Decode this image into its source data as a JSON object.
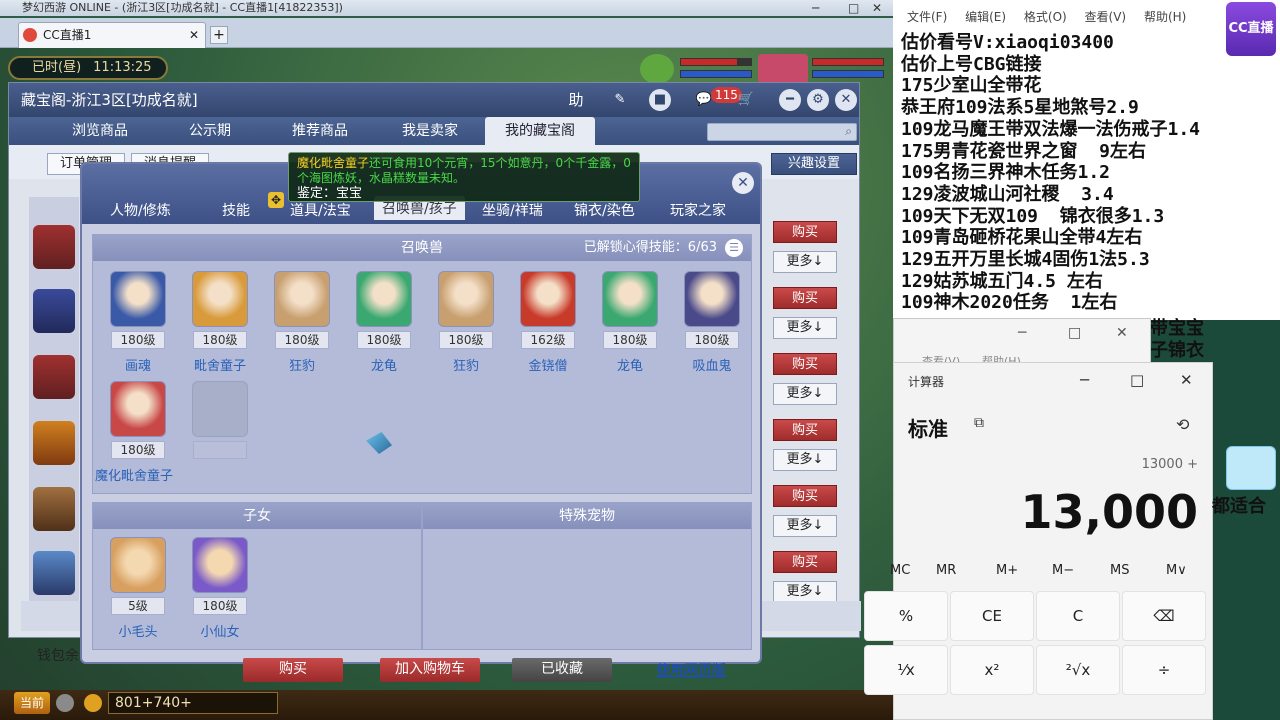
{
  "window": {
    "title": "梦幻西游 ONLINE - (浙江3区[功成名就] - CC直播1[41822353])"
  },
  "browser": {
    "tab_title": "CC直播1",
    "add_tab": "+"
  },
  "game_clock": {
    "period": "已时(昼)",
    "time": "11:13:25"
  },
  "cbg": {
    "title": "藏宝阁-浙江3区[功成名就]",
    "header_icons": [
      "助",
      "pen-icon",
      "stop-icon",
      "chat-icon",
      "cart-icon",
      "minimize-icon",
      "settings-icon",
      "close-icon"
    ],
    "cart_badge": "115",
    "nav_tabs": [
      "浏览商品",
      "公示期",
      "推荐商品",
      "我是卖家",
      "我的藏宝阁"
    ],
    "active_tab": "我的藏宝阁",
    "filter_buttons": [
      "订单管理",
      "消息提醒"
    ],
    "interest_button": "兴趣设置",
    "listing_buttons": {
      "buy": "购买",
      "more": "更多↓"
    },
    "wallet_label": "钱包余"
  },
  "popup": {
    "tabs": [
      "人物/修炼",
      "技能",
      "道具/法宝",
      "召唤兽/孩子",
      "坐骑/祥瑞",
      "锦衣/染色",
      "玩家之家"
    ],
    "active_tab": "召唤兽/孩子",
    "tooltip": {
      "line1_yellow": "魔化毗舍童子",
      "line1_green": "还可食用10个元宵，15个如意丹，0个千金露，0个海图炼妖，水晶糕数量未知。",
      "line2": "鉴定：宝宝"
    },
    "pets_section": {
      "title": "召唤兽",
      "skill_label": "已解锁心得技能：",
      "skill_count": "6/63",
      "pets": [
        {
          "level": "180级",
          "name": "画魂",
          "color": "#3a5aa8"
        },
        {
          "level": "180级",
          "name": "毗舍童子",
          "color": "#d89a3a"
        },
        {
          "level": "180级",
          "name": "狂豹",
          "color": "#c8a070"
        },
        {
          "level": "180级",
          "name": "龙龟",
          "color": "#3aa870"
        },
        {
          "level": "180级",
          "name": "狂豹",
          "color": "#c8a070"
        },
        {
          "level": "162级",
          "name": "金铙僧",
          "color": "#c83a2a"
        },
        {
          "level": "180级",
          "name": "龙龟",
          "color": "#3aa870"
        },
        {
          "level": "180级",
          "name": "吸血鬼",
          "color": "#4a4a8a"
        },
        {
          "level": "180级",
          "name": "魔化毗舍童子",
          "color": "#c84848"
        },
        {
          "level": "",
          "name": "",
          "color": ""
        }
      ]
    },
    "kids_section": {
      "title": "子女",
      "kids": [
        {
          "level": "5级",
          "name": "小毛头",
          "color": "#d8a060"
        },
        {
          "level": "180级",
          "name": "小仙女",
          "color": "#7a5ac8"
        }
      ]
    },
    "special_section": {
      "title": "特殊宠物"
    },
    "actions": {
      "buy": "购买",
      "add_cart": "加入购物车",
      "favorited": "已收藏",
      "web_version": "使用网页版"
    }
  },
  "notepad": {
    "menu": [
      "文件(F)",
      "编辑(E)",
      "格式(O)",
      "查看(V)",
      "帮助(H)"
    ],
    "lines": [
      "估价看号V:xiaoqi03400",
      "估价上号CBG链接",
      "175少室山全带花",
      "恭王府109法系5星地煞号2.9",
      "109龙马魔王带双法爆一法伤戒子1.4",
      "175男青花瓷世界之窗  9左右",
      "109名扬三界神木任务1.2",
      "129凌波城山河社稷  3.4",
      "109天下无双109  锦衣很多1.3",
      "109青岛砸桥花果山全带4左右",
      "129五开万里长城4固伤1法5.3",
      "129姑苏城五门4.5 左右",
      "109神木2020任务  1左右"
    ],
    "overflow_lines": [
      "带宝宝",
      "子锦衣"
    ]
  },
  "cc_logo": "CC直播",
  "back_window": {
    "menu": [
      "查看(V)",
      "帮助(H)"
    ]
  },
  "calculator": {
    "title": "计算器",
    "mode": "标准",
    "expression": "13000 +",
    "display": "13,000",
    "memory_keys": [
      "MC",
      "MR",
      "M+",
      "M−",
      "MS",
      "M∨"
    ],
    "keys_row1": [
      "%",
      "CE",
      "C",
      "⌫"
    ],
    "keys_row2": [
      "¹⁄x",
      "x²",
      "²√x",
      "÷"
    ]
  },
  "right_partial_text": "都适合",
  "game_bar": {
    "current_button": "当前",
    "coords": "801+740+"
  }
}
